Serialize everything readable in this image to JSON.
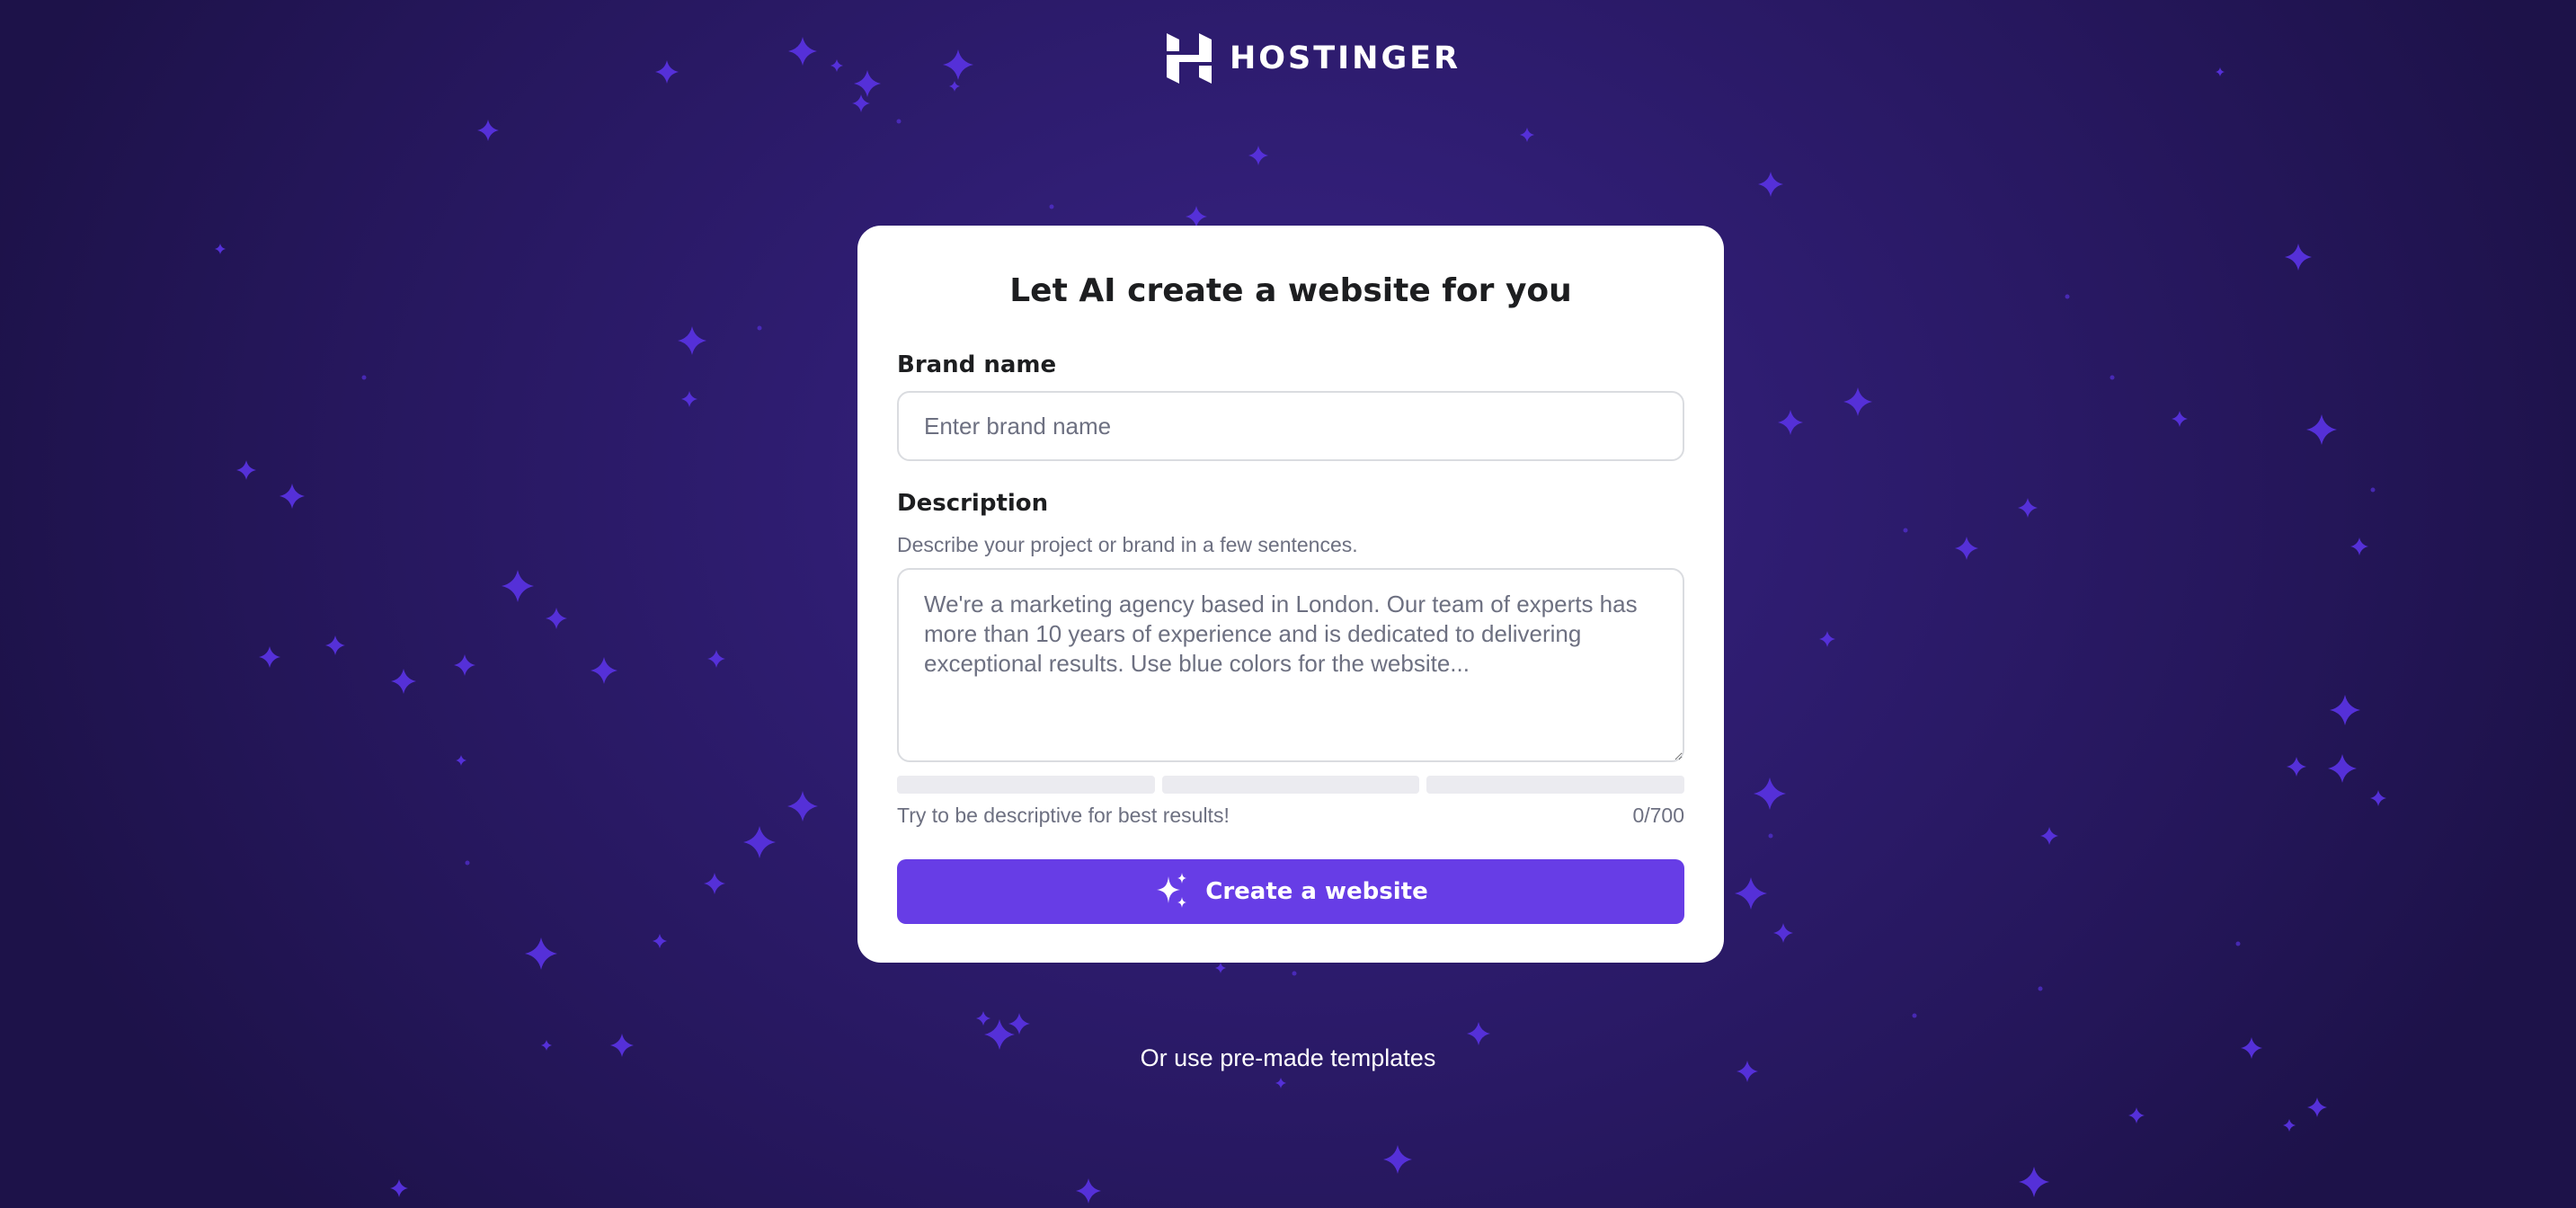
{
  "brand": {
    "logo_text": "HOSTINGER",
    "logo_icon": "hostinger-h-logo-icon"
  },
  "form": {
    "title": "Let AI create a website for you",
    "brand_name": {
      "label": "Brand name",
      "placeholder": "Enter brand name",
      "value": ""
    },
    "description": {
      "label": "Description",
      "hint": "Describe your project or brand in a few sentences.",
      "placeholder": "We're a marketing agency based in London. Our team of experts has more than 10 years of experience and is dedicated to delivering exceptional results. Use blue colors for the website...",
      "value": ""
    },
    "strength_segments": 3,
    "helper_text": "Try to be descriptive for best results!",
    "char_counter": "0/700",
    "submit": {
      "label": "Create a website",
      "icon": "sparkle-icon"
    }
  },
  "footer_link": "Or use pre-made templates",
  "colors": {
    "background": "#2f1d72",
    "accent": "#673de6",
    "card": "#ffffff",
    "star": "#5530d8",
    "text_primary": "#1d1e20",
    "text_secondary": "#6d7081"
  }
}
